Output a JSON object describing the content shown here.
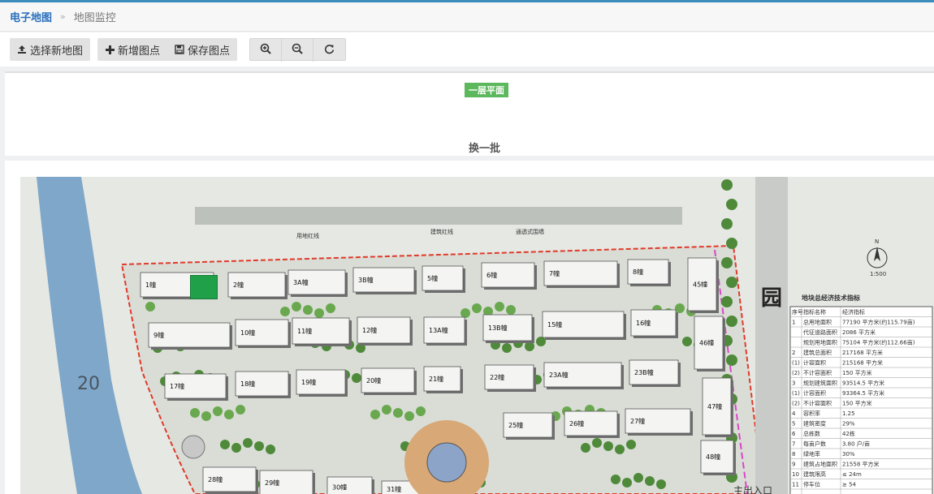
{
  "breadcrumb": {
    "root": "电子地图",
    "sep": "»",
    "current": "地图监控"
  },
  "toolbar": {
    "select_map": "选择新地图",
    "add_point": "新增图点",
    "save_point": "保存图点",
    "zoom_in_icon": "zoom-in-icon",
    "zoom_out_icon": "zoom-out-icon",
    "reset_icon": "refresh-icon"
  },
  "floors": {
    "current": "一层平面",
    "swap": "换一批"
  },
  "map": {
    "road_number": "20",
    "park_char": "园",
    "entrance_text": "主出入口",
    "table_title": "地块总经济技术指标",
    "table_header": [
      "序号",
      "指标名称",
      "经济指标"
    ],
    "table_rows": [
      [
        "1",
        "总用地面积",
        "77190 平方米(约115.79亩)"
      ],
      [
        "",
        "代征道路面积",
        "2086 平方米"
      ],
      [
        "",
        "规划用地面积",
        "75104 平方米(约112.66亩)"
      ],
      [
        "2",
        "建筑总面积",
        "217168 平方米"
      ],
      [
        "(1)",
        "计容面积",
        "215168 平方米"
      ],
      [
        "(2)",
        "不计容面积",
        "150 平方米"
      ],
      [
        "3",
        "规划建筑面积",
        "93514.5 平方米"
      ],
      [
        "(1)",
        "计容面积",
        "93364.5 平方米"
      ],
      [
        "(2)",
        "不计容面积",
        "150 平方米"
      ],
      [
        "4",
        "容积率",
        "1.25"
      ],
      [
        "5",
        "建筑密度",
        "29%"
      ],
      [
        "6",
        "总栋数",
        "42栋"
      ],
      [
        "7",
        "每亩户数",
        "3.80 户/亩"
      ],
      [
        "8",
        "绿地率",
        "30%"
      ],
      [
        "9",
        "建筑占地面积",
        "21558 平方米"
      ],
      [
        "10",
        "建筑限高",
        "≤ 24m"
      ],
      [
        "11",
        "停车位",
        "≥ 54"
      ]
    ],
    "labels": {
      "boundary": "用地红线",
      "fence": "建筑红线",
      "wall": "通透式围墙",
      "scale": "1:500",
      "north": "N"
    },
    "buildings": [
      {
        "id": "b1",
        "label": "1幢"
      },
      {
        "id": "b2",
        "label": "2幢"
      },
      {
        "id": "b3",
        "label": "3A幢"
      },
      {
        "id": "b4",
        "label": "3B幢"
      },
      {
        "id": "b5",
        "label": "5幢"
      },
      {
        "id": "b6",
        "label": "6幢"
      },
      {
        "id": "b7",
        "label": "7幢"
      },
      {
        "id": "b8",
        "label": "8幢"
      },
      {
        "id": "b9",
        "label": "9幢"
      },
      {
        "id": "b10",
        "label": "10幢"
      },
      {
        "id": "b11",
        "label": "11幢"
      },
      {
        "id": "b12",
        "label": "12幢"
      },
      {
        "id": "b13",
        "label": "13A幢"
      },
      {
        "id": "b14",
        "label": "13B幢"
      },
      {
        "id": "b15",
        "label": "15幢"
      },
      {
        "id": "b16",
        "label": "16幢"
      },
      {
        "id": "b17",
        "label": "17幢"
      },
      {
        "id": "b18",
        "label": "18幢"
      },
      {
        "id": "b19",
        "label": "19幢"
      },
      {
        "id": "b20",
        "label": "20幢"
      },
      {
        "id": "b21",
        "label": "21幢"
      },
      {
        "id": "b22",
        "label": "22幢"
      },
      {
        "id": "b23",
        "label": "23A幢"
      },
      {
        "id": "b24",
        "label": "23B幢"
      },
      {
        "id": "b25",
        "label": "25幢"
      },
      {
        "id": "b26",
        "label": "26幢"
      },
      {
        "id": "b27",
        "label": "27幢"
      },
      {
        "id": "b28",
        "label": "28幢"
      },
      {
        "id": "b29",
        "label": "29幢"
      },
      {
        "id": "b30",
        "label": "30幢"
      },
      {
        "id": "b31",
        "label": "31幢"
      },
      {
        "id": "b45",
        "label": "45幢"
      },
      {
        "id": "b46",
        "label": "46幢"
      },
      {
        "id": "b47",
        "label": "47幢"
      },
      {
        "id": "b48",
        "label": "48幢"
      }
    ],
    "colors": {
      "green": "#21a04a",
      "boundary": "#e03a2a",
      "setback": "#d946c8",
      "river": "#7fa7c9"
    }
  }
}
